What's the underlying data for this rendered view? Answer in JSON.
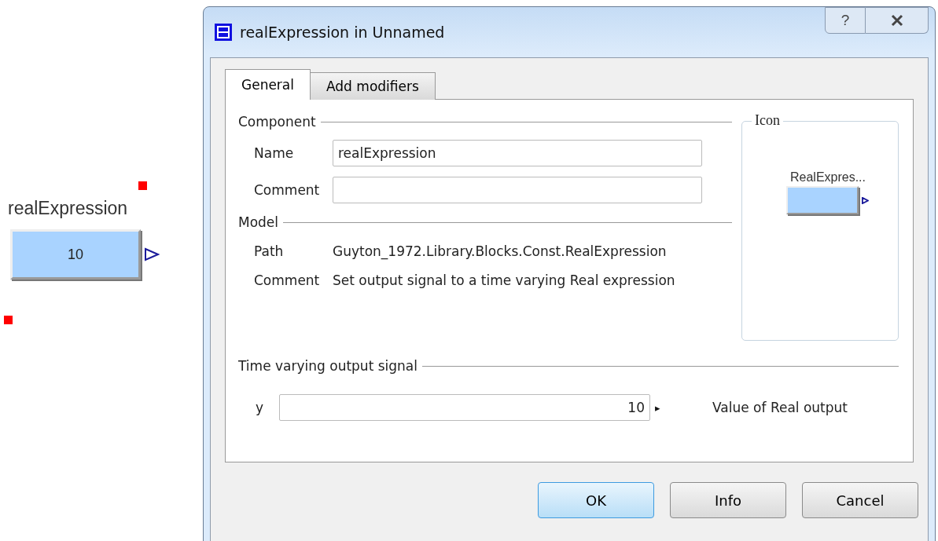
{
  "canvas": {
    "block": {
      "label": "realExpression",
      "value": "10"
    }
  },
  "dialog": {
    "title": "realExpression in Unnamed",
    "help": "?",
    "tabs": [
      {
        "label": "General",
        "selected": true
      },
      {
        "label": "Add modifiers",
        "selected": false
      }
    ],
    "component": {
      "legend": "Component",
      "fields": [
        {
          "label": "Name",
          "value": "realExpression"
        },
        {
          "label": "Comment"
        }
      ]
    },
    "icon": {
      "legend": "Icon",
      "label": "RealExpres..."
    },
    "model": {
      "legend": "Model",
      "rows": [
        {
          "label": "Path",
          "value": "Guyton_1972.Library.Blocks.Const.RealExpression"
        },
        {
          "label": "Comment",
          "value": "Set output signal to a time varying Real expression"
        }
      ]
    },
    "signal": {
      "legend": "Time varying output signal",
      "name": "y",
      "value": "10",
      "arrow": "▸",
      "description": "Value of Real output"
    },
    "buttons": [
      {
        "label": "OK",
        "default": true
      },
      {
        "label": "Info",
        "default": false
      },
      {
        "label": "Cancel",
        "default": false
      }
    ]
  }
}
